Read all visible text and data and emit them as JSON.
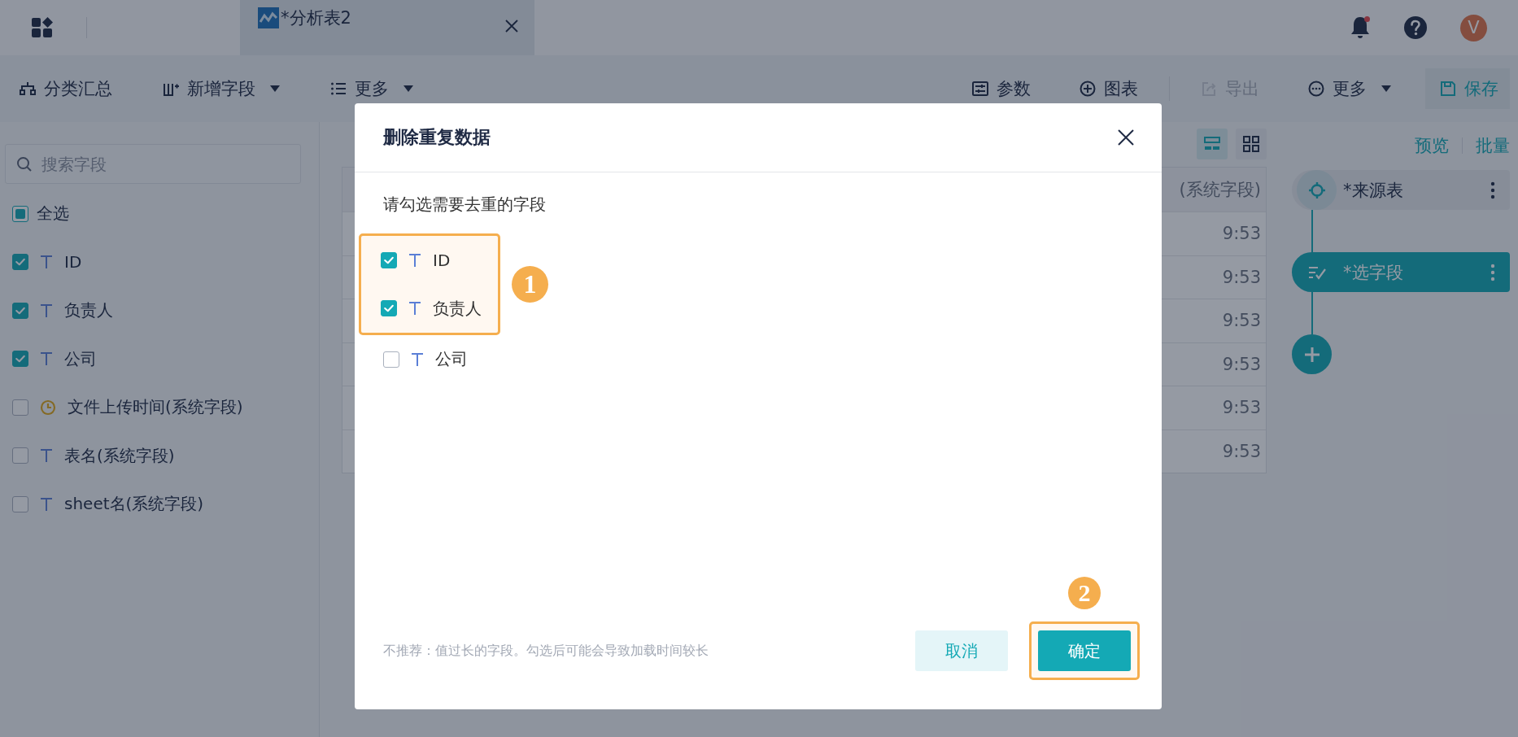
{
  "top_bar": {
    "tabs": [
      {
        "label": "*分析表2",
        "selected": true
      }
    ],
    "notification": true,
    "avatar": "V"
  },
  "toolbar": {
    "left": [
      {
        "label": "分类汇总",
        "dropdown": false
      },
      {
        "label": "新增字段",
        "dropdown": true
      },
      {
        "label": "更多",
        "dropdown": true
      }
    ],
    "right": [
      {
        "label": "参数",
        "kind": "action",
        "dropdown": false,
        "disabled": false
      },
      {
        "label": "图表",
        "kind": "action",
        "dropdown": false,
        "disabled": false
      },
      {
        "label": "导出",
        "kind": "action",
        "dropdown": false,
        "disabled": true
      },
      {
        "label": "更多",
        "kind": "action",
        "dropdown": true,
        "disabled": false
      },
      {
        "label": "保存",
        "kind": "save",
        "dropdown": false,
        "disabled": false
      }
    ]
  },
  "sidebar": {
    "search": {
      "placeholder": "搜索字段"
    },
    "select_all": {
      "label": "全选",
      "checked": false,
      "indeterminate": true
    },
    "fields": [
      {
        "label": "ID",
        "kind": "text",
        "checked": true
      },
      {
        "label": "负责人",
        "kind": "text",
        "checked": true
      },
      {
        "label": "公司",
        "kind": "text",
        "checked": true
      },
      {
        "label": "文件上传时间(系统字段)",
        "kind": "time",
        "checked": false
      },
      {
        "label": "表名(系统字段)",
        "kind": "text",
        "checked": false
      },
      {
        "label": "sheet名(系统字段)",
        "kind": "text",
        "checked": false
      }
    ]
  },
  "view_toggle": [
    {
      "selected": true
    },
    {
      "selected": false
    }
  ],
  "table": {
    "visible_column": {
      "header": "(系统字段)",
      "cells": [
        "9:53",
        "9:53",
        "9:53",
        "9:53",
        "9:53",
        "9:53"
      ]
    }
  },
  "flow_panel": {
    "links": [
      "预览",
      "批量"
    ],
    "nodes": [
      {
        "label": "*来源表",
        "kind": "source",
        "selected": false
      },
      {
        "label": "*选字段",
        "kind": "select",
        "selected": true
      }
    ]
  },
  "dialog": {
    "title": "删除重复数据",
    "prompt": "请勾选需要去重的字段",
    "group_badge": "1",
    "fields": [
      {
        "label": "ID",
        "kind": "text",
        "checked": true,
        "highlighted": true
      },
      {
        "label": "负责人",
        "kind": "text",
        "checked": true,
        "highlighted": true
      },
      {
        "label": "公司",
        "kind": "text",
        "checked": false,
        "highlighted": false
      }
    ],
    "note": "不推荐：值过长的字段。勾选后可能会导致加载时间较长",
    "cancel": "取消",
    "confirm": "确定",
    "confirm_badge": "2"
  }
}
